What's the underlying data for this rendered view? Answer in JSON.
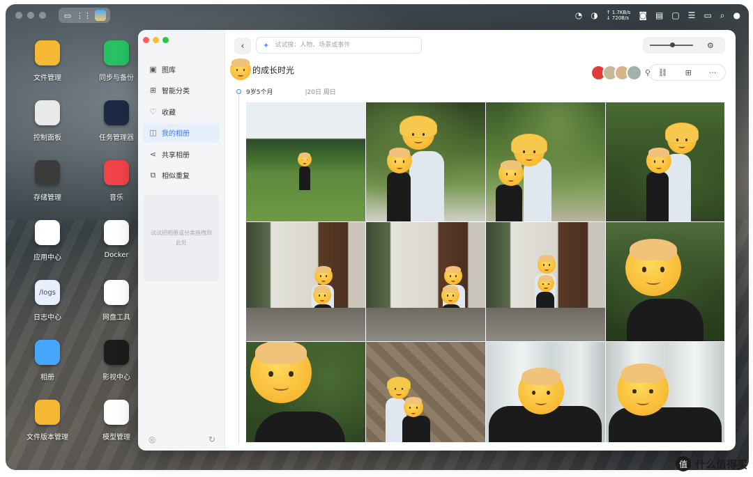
{
  "desktop": {
    "icons": [
      {
        "label": "文件管理",
        "icon": "folder-icon",
        "color": "#f7b933"
      },
      {
        "label": "同步与备份",
        "icon": "sync-icon",
        "color": "#27c163"
      },
      {
        "label": "控制面板",
        "icon": "sliders-icon",
        "color": "#e9e9ea"
      },
      {
        "label": "任务管理器",
        "icon": "chart-icon",
        "color": "#1e2a44"
      },
      {
        "label": "存储管理",
        "icon": "storage-icon",
        "color": "#3b3b3b"
      },
      {
        "label": "音乐",
        "icon": "music-icon",
        "color": "#f0434a"
      },
      {
        "label": "应用中心",
        "icon": "appcenter-icon",
        "color": "#ffffff"
      },
      {
        "label": "Docker",
        "icon": "docker-icon",
        "color": "#ffffff"
      },
      {
        "label": "日志中心",
        "icon": "logs-icon",
        "color": "#e8eefc",
        "glyph": "/logs"
      },
      {
        "label": "网盘工具",
        "icon": "cloud-drive-icon",
        "color": "#ffffff"
      },
      {
        "label": "相册",
        "icon": "photos-icon",
        "color": "#47a7ff"
      },
      {
        "label": "影视中心",
        "icon": "video-icon",
        "color": "#1c1c1c"
      },
      {
        "label": "文件版本管理",
        "icon": "version-icon",
        "color": "#f7b933"
      },
      {
        "label": "模型管理",
        "icon": "model-icon",
        "color": "#ffffff"
      }
    ]
  },
  "topbar": {
    "net_up": "↑ 1.7KB/s",
    "net_down": "↓ 720B/s",
    "tray_icons": [
      "speed-icon",
      "network-icon",
      "user-status-icon",
      "list-icon",
      "monitor-icon",
      "tasks-icon",
      "chat-icon",
      "search-icon",
      "account-icon"
    ]
  },
  "app": {
    "sidebar": {
      "items": [
        {
          "label": "图库",
          "icon": "gallery-icon",
          "glyph": "▣",
          "active": false
        },
        {
          "label": "智能分类",
          "icon": "smart-category-icon",
          "glyph": "⊞",
          "active": false
        },
        {
          "label": "收藏",
          "icon": "heart-icon",
          "glyph": "♡",
          "active": false
        },
        {
          "label": "我的相册",
          "icon": "album-icon",
          "glyph": "◫",
          "active": true
        },
        {
          "label": "共享相册",
          "icon": "share-icon",
          "glyph": "⋖",
          "active": false
        },
        {
          "label": "相似重复",
          "icon": "duplicate-icon",
          "glyph": "⧉",
          "active": false
        }
      ],
      "dropzone_text": "试试把相册或分类拖拽到此处"
    },
    "search": {
      "placeholder": "试试搜：人物、场景或事件"
    },
    "album": {
      "title": "的成长时光",
      "date_age": "9岁5个月",
      "date_day": "|20日 周日"
    },
    "accent": "#3c7cf0"
  }
}
